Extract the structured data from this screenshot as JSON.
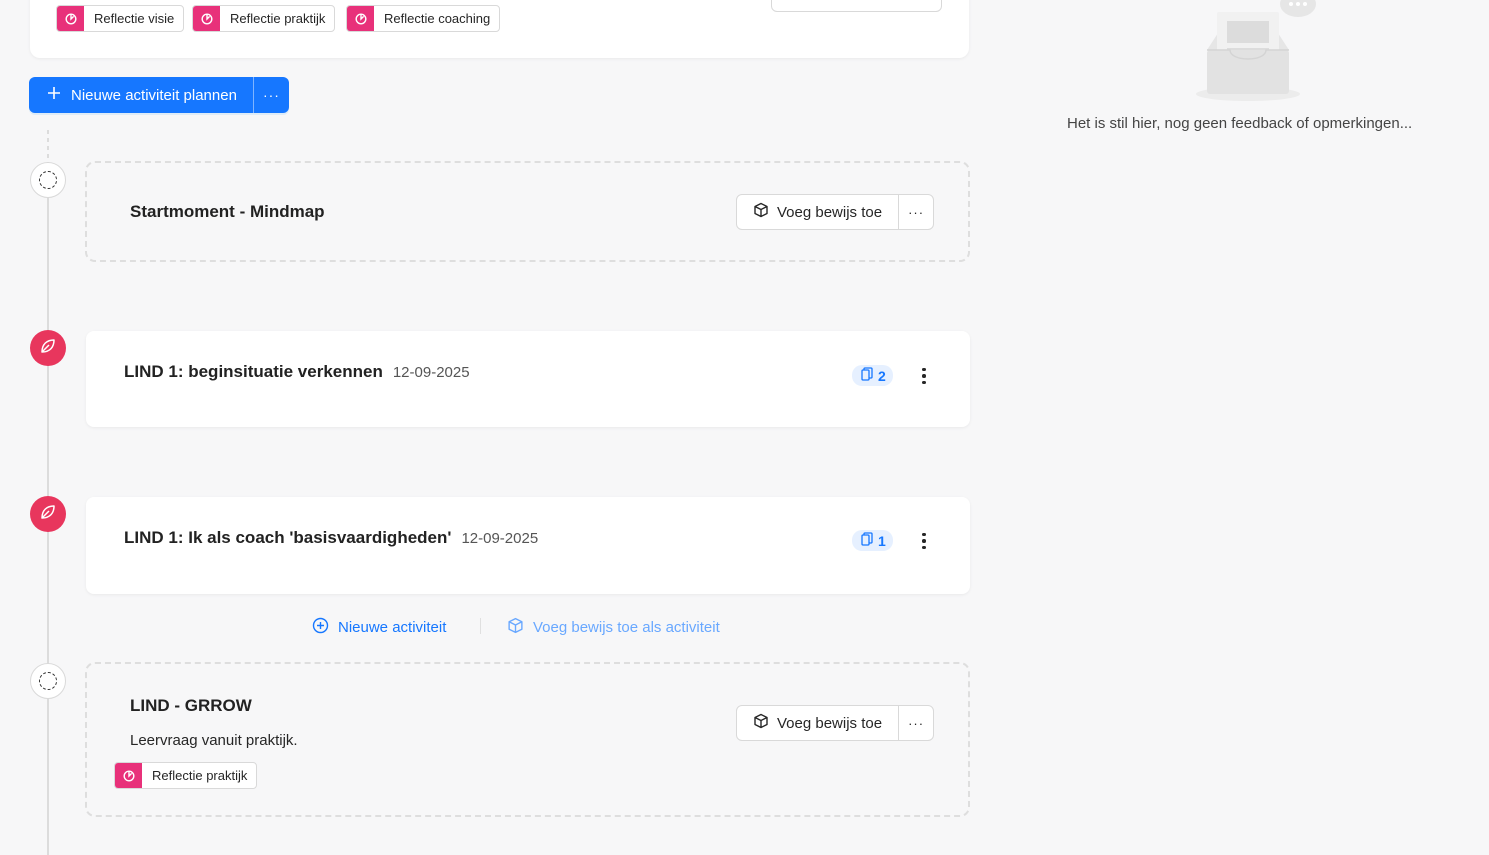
{
  "top_card": {
    "tags": [
      {
        "label": "Reflectie visie"
      },
      {
        "label": "Reflectie praktijk"
      },
      {
        "label": "Reflectie coaching"
      }
    ]
  },
  "toolbar": {
    "new_activity_label": "Nieuwe activiteit plannen",
    "more_label": "···"
  },
  "timeline": [
    {
      "type": "planned",
      "title": "Startmoment - Mindmap",
      "evidence_button": "Voeg bewijs toe",
      "more_label": "···"
    },
    {
      "type": "activity",
      "title": "LIND 1: beginsituatie verkennen",
      "date": "12-09-2025",
      "count": "2"
    },
    {
      "type": "activity",
      "title": "LIND 1: Ik als coach 'basisvaardigheden'",
      "date": "12-09-2025",
      "count": "1"
    },
    {
      "type": "planned",
      "title": "LIND - GRROW",
      "description": "Leervraag vanuit praktijk.",
      "tag": "Reflectie praktijk",
      "evidence_button": "Voeg bewijs toe",
      "more_label": "···"
    }
  ],
  "actions": {
    "new_activity": "Nieuwe activiteit",
    "add_evidence_activity": "Voeg bewijs toe als activiteit"
  },
  "feedback_panel": {
    "empty_text": "Het is stil hier, nog geen feedback of opmerkingen..."
  },
  "colors": {
    "primary": "#1677ff",
    "tag_accent": "#e8317a",
    "node_red": "#e8365d"
  }
}
